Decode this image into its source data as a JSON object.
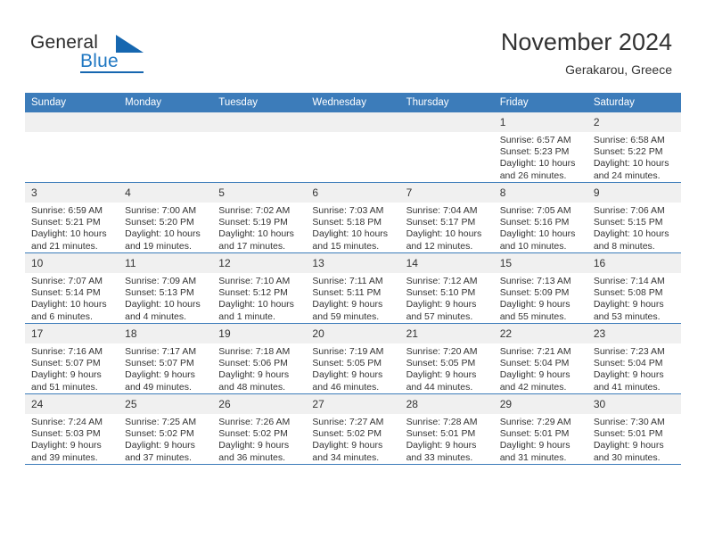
{
  "brand": {
    "name_top": "General",
    "name_bottom": "Blue",
    "triangle_icon": "triangle-logo-icon",
    "accent_color": "#1667b0"
  },
  "header": {
    "title": "November 2024",
    "location": "Gerakarou, Greece"
  },
  "theme": {
    "header_blue": "#3c7cba",
    "daynum_bg": "#f0f0f0",
    "text": "#333333"
  },
  "weekday_headers": [
    "Sunday",
    "Monday",
    "Tuesday",
    "Wednesday",
    "Thursday",
    "Friday",
    "Saturday"
  ],
  "weeks": [
    [
      {
        "day": "",
        "blank": true
      },
      {
        "day": "",
        "blank": true
      },
      {
        "day": "",
        "blank": true
      },
      {
        "day": "",
        "blank": true
      },
      {
        "day": "",
        "blank": true
      },
      {
        "day": "1",
        "sunrise": "Sunrise: 6:57 AM",
        "sunset": "Sunset: 5:23 PM",
        "daylight_1": "Daylight: 10 hours",
        "daylight_2": "and 26 minutes."
      },
      {
        "day": "2",
        "sunrise": "Sunrise: 6:58 AM",
        "sunset": "Sunset: 5:22 PM",
        "daylight_1": "Daylight: 10 hours",
        "daylight_2": "and 24 minutes."
      }
    ],
    [
      {
        "day": "3",
        "sunrise": "Sunrise: 6:59 AM",
        "sunset": "Sunset: 5:21 PM",
        "daylight_1": "Daylight: 10 hours",
        "daylight_2": "and 21 minutes."
      },
      {
        "day": "4",
        "sunrise": "Sunrise: 7:00 AM",
        "sunset": "Sunset: 5:20 PM",
        "daylight_1": "Daylight: 10 hours",
        "daylight_2": "and 19 minutes."
      },
      {
        "day": "5",
        "sunrise": "Sunrise: 7:02 AM",
        "sunset": "Sunset: 5:19 PM",
        "daylight_1": "Daylight: 10 hours",
        "daylight_2": "and 17 minutes."
      },
      {
        "day": "6",
        "sunrise": "Sunrise: 7:03 AM",
        "sunset": "Sunset: 5:18 PM",
        "daylight_1": "Daylight: 10 hours",
        "daylight_2": "and 15 minutes."
      },
      {
        "day": "7",
        "sunrise": "Sunrise: 7:04 AM",
        "sunset": "Sunset: 5:17 PM",
        "daylight_1": "Daylight: 10 hours",
        "daylight_2": "and 12 minutes."
      },
      {
        "day": "8",
        "sunrise": "Sunrise: 7:05 AM",
        "sunset": "Sunset: 5:16 PM",
        "daylight_1": "Daylight: 10 hours",
        "daylight_2": "and 10 minutes."
      },
      {
        "day": "9",
        "sunrise": "Sunrise: 7:06 AM",
        "sunset": "Sunset: 5:15 PM",
        "daylight_1": "Daylight: 10 hours",
        "daylight_2": "and 8 minutes."
      }
    ],
    [
      {
        "day": "10",
        "sunrise": "Sunrise: 7:07 AM",
        "sunset": "Sunset: 5:14 PM",
        "daylight_1": "Daylight: 10 hours",
        "daylight_2": "and 6 minutes."
      },
      {
        "day": "11",
        "sunrise": "Sunrise: 7:09 AM",
        "sunset": "Sunset: 5:13 PM",
        "daylight_1": "Daylight: 10 hours",
        "daylight_2": "and 4 minutes."
      },
      {
        "day": "12",
        "sunrise": "Sunrise: 7:10 AM",
        "sunset": "Sunset: 5:12 PM",
        "daylight_1": "Daylight: 10 hours",
        "daylight_2": "and 1 minute."
      },
      {
        "day": "13",
        "sunrise": "Sunrise: 7:11 AM",
        "sunset": "Sunset: 5:11 PM",
        "daylight_1": "Daylight: 9 hours",
        "daylight_2": "and 59 minutes."
      },
      {
        "day": "14",
        "sunrise": "Sunrise: 7:12 AM",
        "sunset": "Sunset: 5:10 PM",
        "daylight_1": "Daylight: 9 hours",
        "daylight_2": "and 57 minutes."
      },
      {
        "day": "15",
        "sunrise": "Sunrise: 7:13 AM",
        "sunset": "Sunset: 5:09 PM",
        "daylight_1": "Daylight: 9 hours",
        "daylight_2": "and 55 minutes."
      },
      {
        "day": "16",
        "sunrise": "Sunrise: 7:14 AM",
        "sunset": "Sunset: 5:08 PM",
        "daylight_1": "Daylight: 9 hours",
        "daylight_2": "and 53 minutes."
      }
    ],
    [
      {
        "day": "17",
        "sunrise": "Sunrise: 7:16 AM",
        "sunset": "Sunset: 5:07 PM",
        "daylight_1": "Daylight: 9 hours",
        "daylight_2": "and 51 minutes."
      },
      {
        "day": "18",
        "sunrise": "Sunrise: 7:17 AM",
        "sunset": "Sunset: 5:07 PM",
        "daylight_1": "Daylight: 9 hours",
        "daylight_2": "and 49 minutes."
      },
      {
        "day": "19",
        "sunrise": "Sunrise: 7:18 AM",
        "sunset": "Sunset: 5:06 PM",
        "daylight_1": "Daylight: 9 hours",
        "daylight_2": "and 48 minutes."
      },
      {
        "day": "20",
        "sunrise": "Sunrise: 7:19 AM",
        "sunset": "Sunset: 5:05 PM",
        "daylight_1": "Daylight: 9 hours",
        "daylight_2": "and 46 minutes."
      },
      {
        "day": "21",
        "sunrise": "Sunrise: 7:20 AM",
        "sunset": "Sunset: 5:05 PM",
        "daylight_1": "Daylight: 9 hours",
        "daylight_2": "and 44 minutes."
      },
      {
        "day": "22",
        "sunrise": "Sunrise: 7:21 AM",
        "sunset": "Sunset: 5:04 PM",
        "daylight_1": "Daylight: 9 hours",
        "daylight_2": "and 42 minutes."
      },
      {
        "day": "23",
        "sunrise": "Sunrise: 7:23 AM",
        "sunset": "Sunset: 5:04 PM",
        "daylight_1": "Daylight: 9 hours",
        "daylight_2": "and 41 minutes."
      }
    ],
    [
      {
        "day": "24",
        "sunrise": "Sunrise: 7:24 AM",
        "sunset": "Sunset: 5:03 PM",
        "daylight_1": "Daylight: 9 hours",
        "daylight_2": "and 39 minutes."
      },
      {
        "day": "25",
        "sunrise": "Sunrise: 7:25 AM",
        "sunset": "Sunset: 5:02 PM",
        "daylight_1": "Daylight: 9 hours",
        "daylight_2": "and 37 minutes."
      },
      {
        "day": "26",
        "sunrise": "Sunrise: 7:26 AM",
        "sunset": "Sunset: 5:02 PM",
        "daylight_1": "Daylight: 9 hours",
        "daylight_2": "and 36 minutes."
      },
      {
        "day": "27",
        "sunrise": "Sunrise: 7:27 AM",
        "sunset": "Sunset: 5:02 PM",
        "daylight_1": "Daylight: 9 hours",
        "daylight_2": "and 34 minutes."
      },
      {
        "day": "28",
        "sunrise": "Sunrise: 7:28 AM",
        "sunset": "Sunset: 5:01 PM",
        "daylight_1": "Daylight: 9 hours",
        "daylight_2": "and 33 minutes."
      },
      {
        "day": "29",
        "sunrise": "Sunrise: 7:29 AM",
        "sunset": "Sunset: 5:01 PM",
        "daylight_1": "Daylight: 9 hours",
        "daylight_2": "and 31 minutes."
      },
      {
        "day": "30",
        "sunrise": "Sunrise: 7:30 AM",
        "sunset": "Sunset: 5:01 PM",
        "daylight_1": "Daylight: 9 hours",
        "daylight_2": "and 30 minutes."
      }
    ]
  ]
}
